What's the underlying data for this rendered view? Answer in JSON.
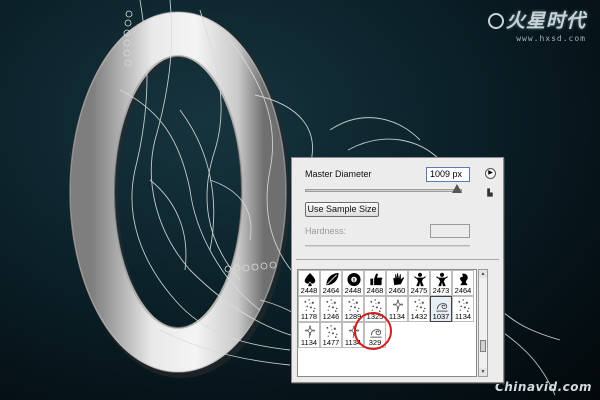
{
  "colors": {
    "accent_ring": "#d21d1d",
    "input_border": "#5a7db0",
    "background": "#061418"
  },
  "logo": {
    "brand": "火星时代",
    "url": "www.hxsd.com"
  },
  "watermark": "Chinavid.com",
  "brush_panel": {
    "master_diameter_label": "Master Diameter",
    "master_diameter_value": "1009 px",
    "master_diameter_fraction": 0.97,
    "menu_icon": "triangle-right-icon",
    "new_brush_icon": "new-brush-icon",
    "use_sample_size_label": "Use Sample Size",
    "hardness_label": "Hardness:",
    "hardness_value": "",
    "brushes": [
      {
        "size": "2448",
        "icon": "spade-shape"
      },
      {
        "size": "2464",
        "icon": "leaf-shape"
      },
      {
        "size": "2448",
        "icon": "eight-ball-shape"
      },
      {
        "size": "2468",
        "icon": "thumbs-up-shape"
      },
      {
        "size": "2460",
        "icon": "hand-shape"
      },
      {
        "size": "2475",
        "icon": "figure-shape"
      },
      {
        "size": "2473",
        "icon": "figure-shape"
      },
      {
        "size": "2464",
        "icon": "chess-piece-shape"
      },
      {
        "size": "1178",
        "icon": "scatter-shape"
      },
      {
        "size": "1246",
        "icon": "scatter-shape"
      },
      {
        "size": "1289",
        "icon": "scatter-shape"
      },
      {
        "size": "1325",
        "icon": "scatter-shape"
      },
      {
        "size": "1134",
        "icon": "flower-shape"
      },
      {
        "size": "1432",
        "icon": "scatter-shape"
      },
      {
        "size": "1037",
        "icon": "swirl-shape"
      },
      {
        "size": "1134",
        "icon": "scatter-shape"
      },
      {
        "size": "1134",
        "icon": "flower-shape"
      },
      {
        "size": "1477",
        "icon": "scatter-shape"
      },
      {
        "size": "1134",
        "icon": "flower-shape"
      },
      {
        "size": "329",
        "icon": "swirl-shape"
      }
    ],
    "selected_index": 14
  }
}
